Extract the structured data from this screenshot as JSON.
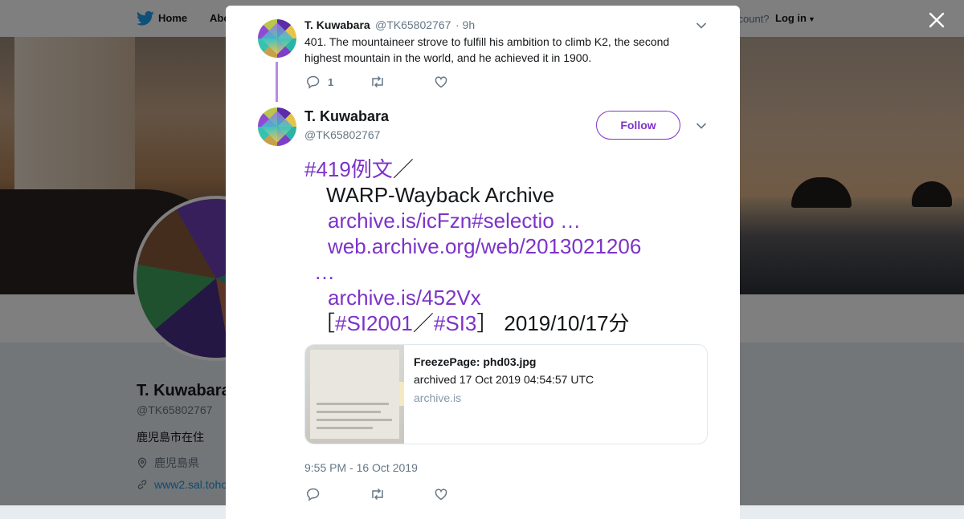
{
  "topnav": {
    "home_label": "Home",
    "about_label": "Abo",
    "account_text": "ccount?",
    "login_label": "Log in"
  },
  "profile": {
    "name": "T. Kuwabara",
    "handle": "@TK65802767",
    "bio": "鹿児島市在住",
    "location": "鹿児島県",
    "url": "www2.sal.toho"
  },
  "thread_tweet": {
    "name": "T. Kuwabara",
    "handle": "@TK65802767",
    "time": "· 9h",
    "text": "401. The mountaineer strove to fulfill his ambition to climb K2, the second highest mountain in the world, and he achieved it in 1900.",
    "reply_count": "1"
  },
  "main_tweet": {
    "name": "T. Kuwabara",
    "handle": "@TK65802767",
    "follow_label": "Follow",
    "lines": {
      "l1_tag": "#419例文",
      "l1_rest": "／",
      "l2": "WARP-Wayback Archive",
      "l3": "archive.is/icFzn#selectio …",
      "l4": "web.archive.org/web/2013021206",
      "l5": "…",
      "l6": "archive.is/452Vx",
      "l7_open": "［",
      "l7_tag1": "#SI2001",
      "l7_sep": "／",
      "l7_tag2": "#SI3",
      "l7_close": "］",
      "l7_date": "2019/10/17分"
    },
    "card": {
      "title": "FreezePage: phd03.jpg",
      "description": "archived 17 Oct 2019 04:54:57 UTC",
      "domain": "archive.is"
    },
    "timestamp": "9:55 PM - 16 Oct 2019"
  },
  "colors": {
    "accent": "#7d33c8",
    "twitter_blue": "#1da1f2",
    "text_secondary": "#657786"
  }
}
